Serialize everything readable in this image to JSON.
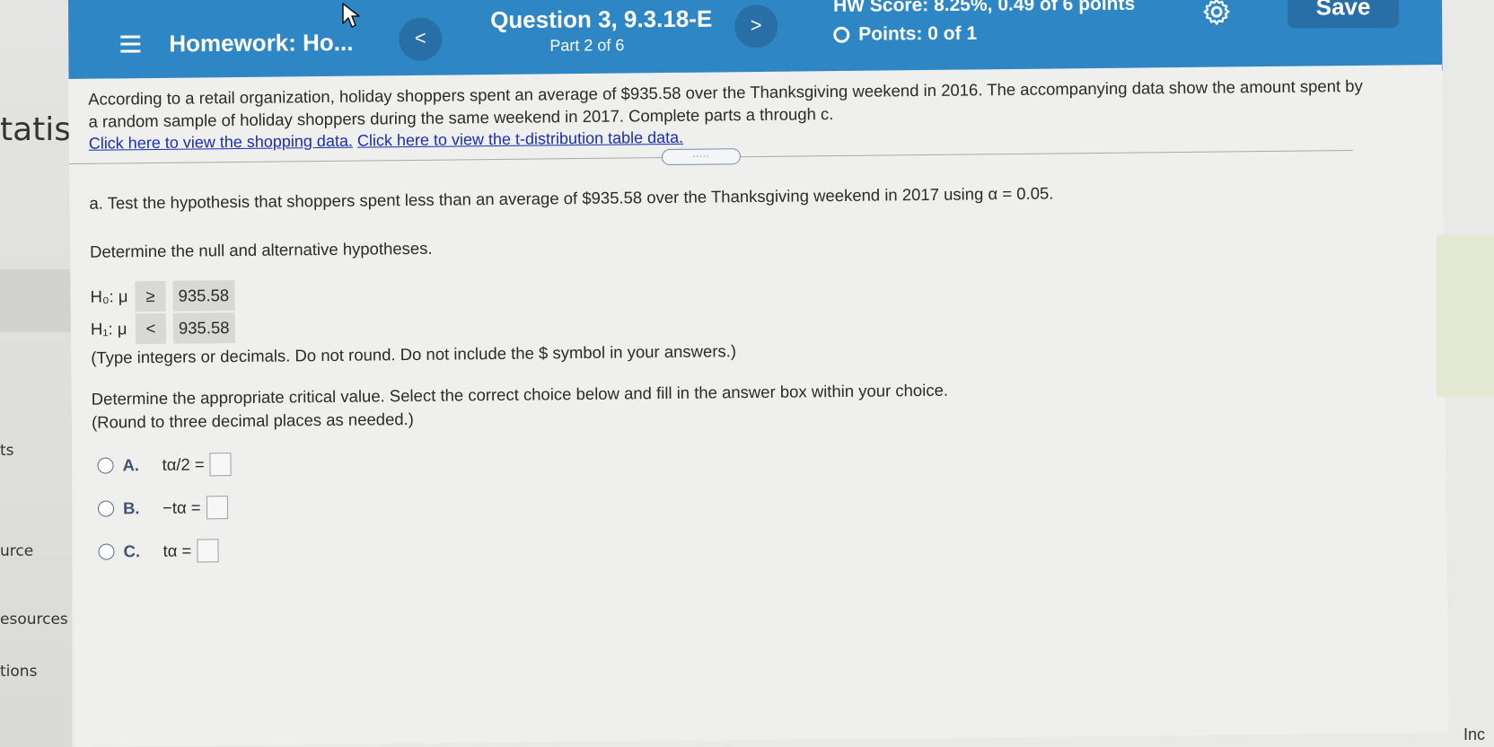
{
  "sidebar": {
    "fragments": [
      "tatis",
      "ts",
      "urce",
      "esources",
      "tions"
    ]
  },
  "topbar": {
    "homework_title": "Homework: Ho...",
    "prev_label": "<",
    "next_label": ">",
    "question_title": "Question 3, 9.3.18-E",
    "part_label": "Part 2 of 6",
    "hw_score": "HW Score: 8.25%, 0.49 of 6 points",
    "points": "Points: 0 of 1",
    "save_label": "Save",
    "color": "#2f86c4"
  },
  "problem": {
    "intro": "According to a retail organization, holiday shoppers spent an average of $935.58 over the Thanksgiving weekend in 2016. The accompanying data show the amount spent by a random sample of holiday shoppers during the same weekend in 2017. Complete parts a through c.",
    "link_shopping": "Click here to view the shopping data.",
    "link_table": "Click here to view the t-distribution table data.",
    "expander": ".....",
    "part_a": "a. Test the hypothesis that shoppers spent less than an average of $935.58 over the Thanksgiving weekend in 2017 using α = 0.05.",
    "determine_hyp": "Determine the null and alternative hypotheses.",
    "h0": {
      "label": "H₀: μ",
      "symbol": "≥",
      "value": "935.58"
    },
    "h1": {
      "label": "H₁: μ",
      "symbol": "<",
      "value": "935.58"
    },
    "type_note": "(Type integers or decimals. Do not round. Do not include the $ symbol in your answers.)",
    "critical_prompt": "Determine the appropriate critical value. Select the correct choice below and fill in the answer box within your choice.",
    "round_note": "(Round to three decimal places as needed.)",
    "choices": [
      {
        "letter": "A.",
        "expr": "tα/2 ="
      },
      {
        "letter": "B.",
        "expr": "−tα ="
      },
      {
        "letter": "C.",
        "expr": "tα ="
      }
    ]
  },
  "corner_fragment": "Inc"
}
